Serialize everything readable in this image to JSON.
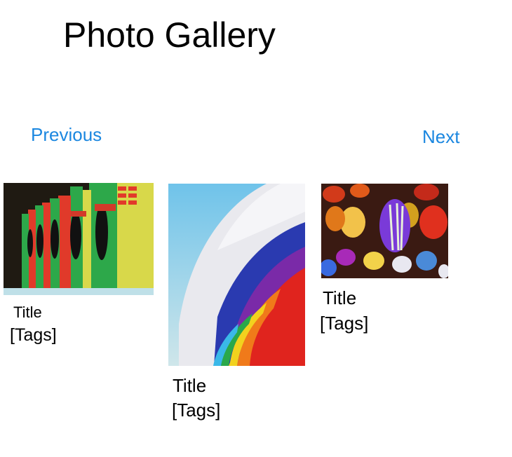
{
  "page": {
    "title": "Photo Gallery"
  },
  "nav": {
    "previous_label": "Previous",
    "next_label": "Next"
  },
  "photos": [
    {
      "title": "Title",
      "tags": "[Tags]",
      "image": "payphones-photo"
    },
    {
      "title": "Title",
      "tags": "[Tags]",
      "image": "hot-air-balloon-photo"
    },
    {
      "title": "Title",
      "tags": "[Tags]",
      "image": "lanterns-photo"
    }
  ],
  "colors": {
    "link": "#1b87e0",
    "text": "#000000",
    "background": "#ffffff"
  }
}
